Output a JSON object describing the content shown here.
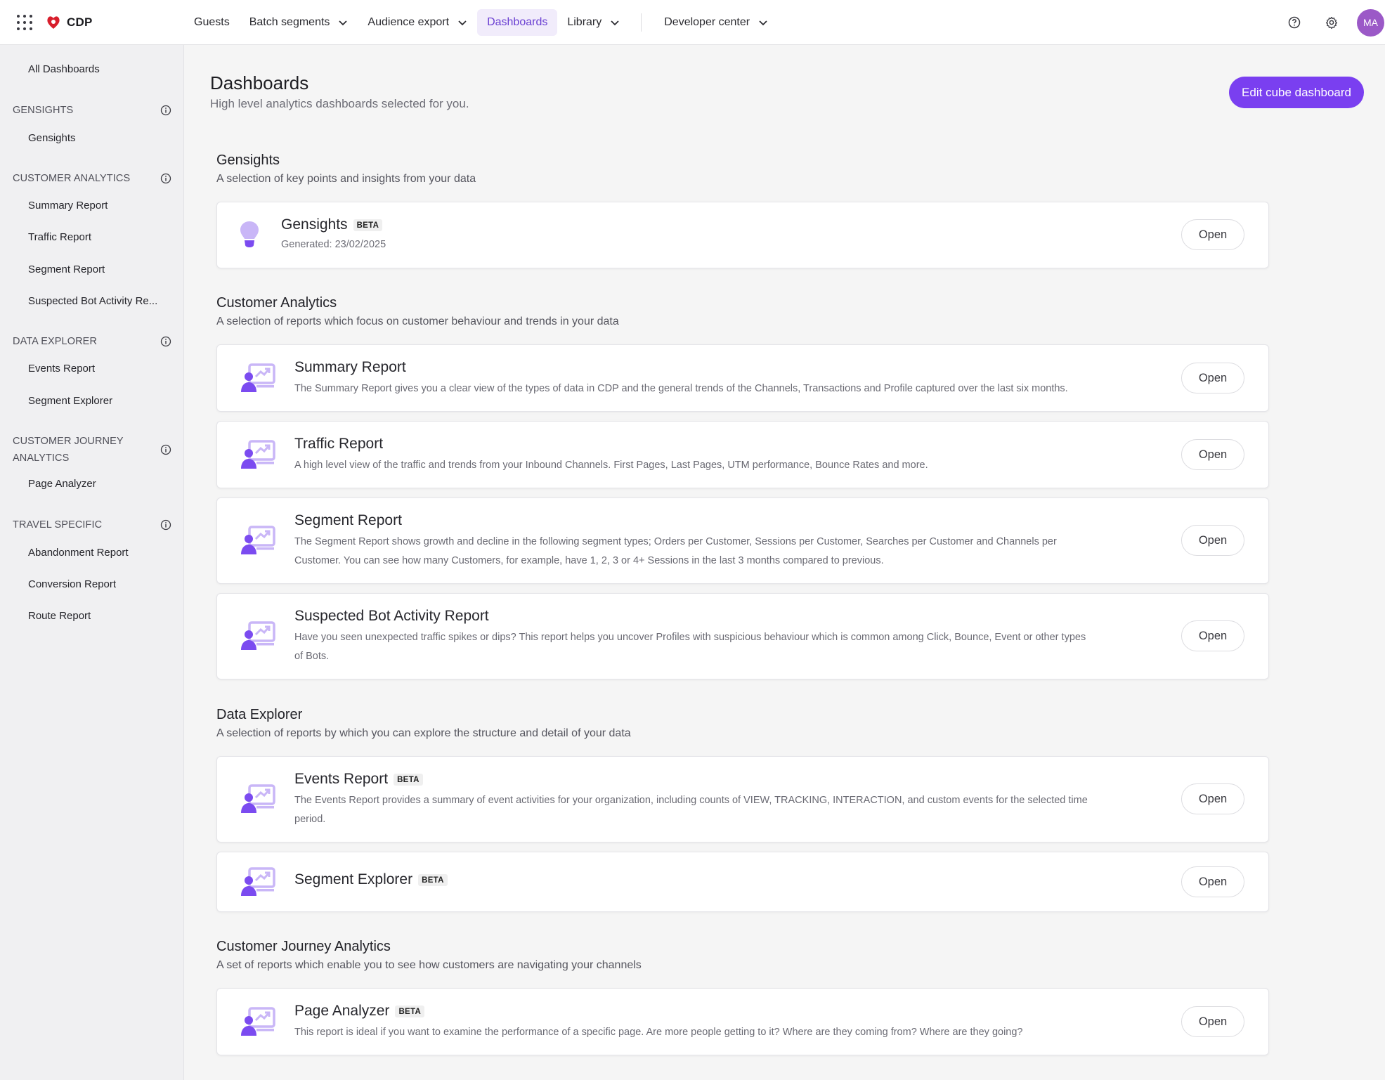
{
  "app": {
    "name": "CDP"
  },
  "topnav": {
    "items": [
      {
        "label": "Guests"
      },
      {
        "label": "Batch segments"
      },
      {
        "label": "Audience export"
      },
      {
        "label": "Dashboards"
      },
      {
        "label": "Library"
      },
      {
        "label": "Developer center"
      }
    ],
    "active": "Dashboards",
    "avatar_initials": "MA"
  },
  "sidebar": {
    "all_dashboards": "All Dashboards",
    "groups": [
      {
        "title": "GENSIGHTS",
        "items": [
          "Gensights"
        ]
      },
      {
        "title": "CUSTOMER ANALYTICS",
        "items": [
          "Summary Report",
          "Traffic Report",
          "Segment Report",
          "Suspected Bot Activity Re..."
        ]
      },
      {
        "title": "DATA EXPLORER",
        "items": [
          "Events Report",
          "Segment Explorer"
        ]
      },
      {
        "title": "CUSTOMER JOURNEY ANALYTICS",
        "items": [
          "Page Analyzer"
        ]
      },
      {
        "title": "TRAVEL SPECIFIC",
        "items": [
          "Abandonment Report",
          "Conversion Report",
          "Route Report"
        ]
      }
    ]
  },
  "page": {
    "title": "Dashboards",
    "subtitle": "High level analytics dashboards selected for you.",
    "edit_button": "Edit cube dashboard"
  },
  "sections": [
    {
      "title": "Gensights",
      "description": "A selection of key points and insights from your data",
      "cards": [
        {
          "title": "Gensights",
          "badge": "BETA",
          "meta": "Generated: 23/02/2025",
          "open": "Open"
        }
      ]
    },
    {
      "title": "Customer Analytics",
      "description": "A selection of reports which focus on customer behaviour and trends in your data",
      "cards": [
        {
          "title": "Summary Report",
          "description": "The Summary Report gives you a clear view of the types of data in CDP and the general trends of the Channels, Transactions and Profile captured over the last six months.",
          "open": "Open"
        },
        {
          "title": "Traffic Report",
          "description": "A high level view of the traffic and trends from your Inbound Channels. First Pages, Last Pages, UTM performance, Bounce Rates and more.",
          "open": "Open"
        },
        {
          "title": "Segment Report",
          "description": "The Segment Report shows growth and decline in the following segment types; Orders per Customer, Sessions per Customer, Searches per Customer and Channels per Customer. You can see how many Customers, for example, have 1, 2, 3 or 4+ Sessions in the last 3 months compared to previous.",
          "open": "Open"
        },
        {
          "title": "Suspected Bot Activity Report",
          "description": "Have you seen unexpected traffic spikes or dips? This report helps you uncover Profiles with suspicious behaviour which is common among Click, Bounce, Event or other types of Bots.",
          "open": "Open"
        }
      ]
    },
    {
      "title": "Data Explorer",
      "description": "A selection of reports by which you can explore the structure and detail of your data",
      "cards": [
        {
          "title": "Events Report",
          "badge": "BETA",
          "description": "The Events Report provides a summary of event activities for your organization, including counts of VIEW, TRACKING, INTERACTION, and custom events for the selected time period.",
          "open": "Open"
        },
        {
          "title": "Segment Explorer",
          "badge": "BETA",
          "open": "Open"
        }
      ]
    },
    {
      "title": "Customer Journey Analytics",
      "description": "A set of reports which enable you to see how customers are navigating your channels",
      "cards": [
        {
          "title": "Page Analyzer",
          "badge": "BETA",
          "description": "This report is ideal if you want to examine the performance of a specific page. Are more people getting to it? Where are they coming from? Where are they going?",
          "open": "Open"
        }
      ]
    }
  ],
  "colors": {
    "accent": "#7a3ff0",
    "active_nav_bg": "#f1ecfb",
    "icon_purple": "#7b4bf0",
    "icon_light": "#c9b6f7"
  }
}
